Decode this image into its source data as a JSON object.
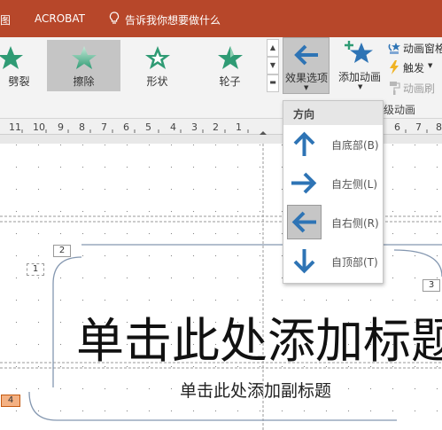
{
  "titlebar": {
    "tab_partial": "图",
    "tab_acrobat": "ACROBAT",
    "tell_me": "告诉我你想要做什么"
  },
  "gallery": {
    "items": [
      {
        "label": "劈裂",
        "selected": false
      },
      {
        "label": "擦除",
        "selected": true
      },
      {
        "label": "形状",
        "selected": false
      },
      {
        "label": "轮子",
        "selected": false
      }
    ]
  },
  "ribbon": {
    "effect_options": "效果选项",
    "add_animation": "添加动画",
    "animation_pane": "动画窗格",
    "trigger": "触发",
    "animation_painter": "动画刷",
    "advanced_animation": "级动画",
    "accent_color": "#2e74b5",
    "gallery_star_color": "#2f9b74"
  },
  "ruler": {
    "ticks": [
      "11",
      "10",
      "9",
      "8",
      "7",
      "6",
      "5",
      "4",
      "3",
      "2",
      "1",
      "6",
      "7",
      "8"
    ]
  },
  "dropdown": {
    "header": "方向",
    "options": [
      {
        "label": "自底部(B)",
        "icon": "arrow-up-icon",
        "selected": false
      },
      {
        "label": "自左侧(L)",
        "icon": "arrow-right-icon",
        "selected": false
      },
      {
        "label": "自右侧(R)",
        "icon": "arrow-left-icon",
        "selected": true
      },
      {
        "label": "自顶部(T)",
        "icon": "arrow-down-icon",
        "selected": false
      }
    ]
  },
  "slide": {
    "title_placeholder": "单击此处添加标题",
    "subtitle_placeholder": "单击此处添加副标题",
    "animation_tags": [
      "1",
      "2",
      "3",
      "4"
    ],
    "tag4_color": "#f4b183"
  }
}
